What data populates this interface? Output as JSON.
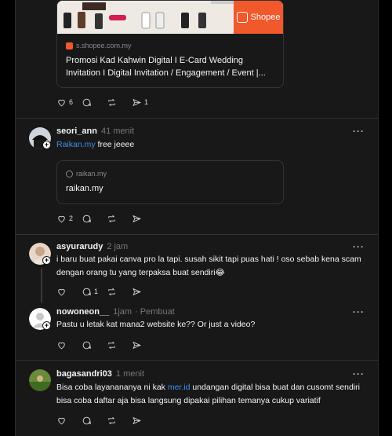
{
  "post1": {
    "card": {
      "badge": "Shopee",
      "domain": "s.shopee.com.my",
      "title": "Promosi Kad Kahwin Digital I E-Card Wedding Invitation I Digital Invitation / Engagement / Event |..."
    },
    "actions": {
      "likes": "6",
      "replies": "",
      "reposts": "",
      "shares": "1"
    }
  },
  "post2": {
    "username": "seori_ann",
    "time": "41 menit",
    "text_link": "Raikan.my",
    "text_rest": " free jeeee",
    "card": {
      "domain": "raikan.my",
      "title": "raikan.my"
    },
    "actions": {
      "likes": "2",
      "replies": "",
      "reposts": "",
      "shares": ""
    }
  },
  "post3": {
    "username": "asyurarudy",
    "time": "2 jam",
    "text": "i baru buat pakai canva pro la tapi. susah sikit tapi puas hati ! oso sebab kena scam dengan orang tu yang terpaksa buat sendiri😂",
    "actions": {
      "likes": "",
      "replies": "1",
      "reposts": "",
      "shares": ""
    }
  },
  "post4": {
    "username": "nowoneon__",
    "time": "1jam",
    "author_tag": "· Pembuat",
    "text": "Pastu u letak kat mana2 website ke?? Or just a video?"
  },
  "post5": {
    "username": "bagasandri03",
    "time": "1 menit",
    "text_a": "Bisa coba layanananya ni kak ",
    "text_link": "mer.id",
    "text_b": " undangan digital bisa buat dan cusomt sendiri bisa coba daftar aja bisa langsung dipakai pilihan temanya cukup variatif"
  },
  "colors": {
    "link": "#3f8ff0",
    "shopee": "#f1582b",
    "panel": "#181818"
  },
  "more_glyph": "···"
}
